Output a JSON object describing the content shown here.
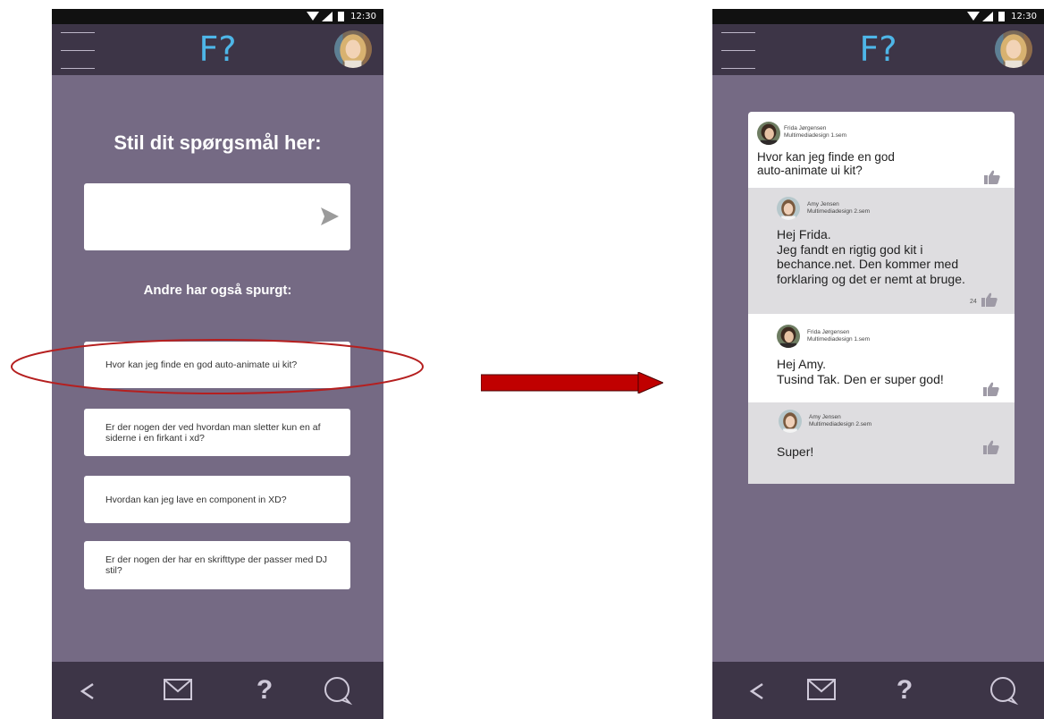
{
  "colors": {
    "background": "#756a84",
    "bar": "#3d3547",
    "logo": "#4eb6e8",
    "reply_grey": "#dedde0",
    "like": "#9e9aa6",
    "arrow": "#c00000",
    "highlight": "#b51f1f"
  },
  "status_bar": {
    "time": "12:30",
    "icons": [
      "wifi-icon",
      "signal-icon",
      "battery-icon"
    ]
  },
  "app_bar": {
    "logo": "F?",
    "icons": [
      "hamburger-menu-icon",
      "profile-avatar"
    ]
  },
  "bottom_nav": {
    "items": [
      "back-icon",
      "mail-icon",
      "question-icon",
      "chat-icon"
    ],
    "question_glyph": "?"
  },
  "screen1": {
    "title": "Stil dit spørgsmål her:",
    "question_input": {
      "value": "",
      "placeholder": ""
    },
    "others_title": "Andre har også spurgt:",
    "questions": [
      "Hvor kan jeg finde en god auto-animate ui kit?",
      "Er der nogen der ved hvordan man sletter kun en af siderne i en firkant i xd?",
      "Hvordan kan jeg lave en component in XD?",
      "Er der nogen der har en skrifttype der passer med DJ stil?"
    ],
    "highlighted_question_index": 0
  },
  "screen2": {
    "posts": [
      {
        "author": "Frida Jørgensen",
        "course": "Multimediadesign 1.sem",
        "text": "Hvor kan jeg finde en god\nauto-animate ui kit?",
        "likes": ""
      },
      {
        "author": "Amy Jensen",
        "course": "Multimediadesign 2.sem",
        "text": "Hej Frida.\nJeg fandt en rigtig god kit i bechance.net. Den kommer med forklaring og det er nemt at bruge.",
        "likes": "24"
      },
      {
        "author": "Frida Jørgensen",
        "course": "Multimediadesign 1.sem",
        "text": "Hej Amy.\nTusind Tak. Den er super god!",
        "likes": ""
      },
      {
        "author": "Amy Jensen",
        "course": "Multimediadesign 2.sem",
        "text": "Super!",
        "likes": ""
      }
    ]
  }
}
